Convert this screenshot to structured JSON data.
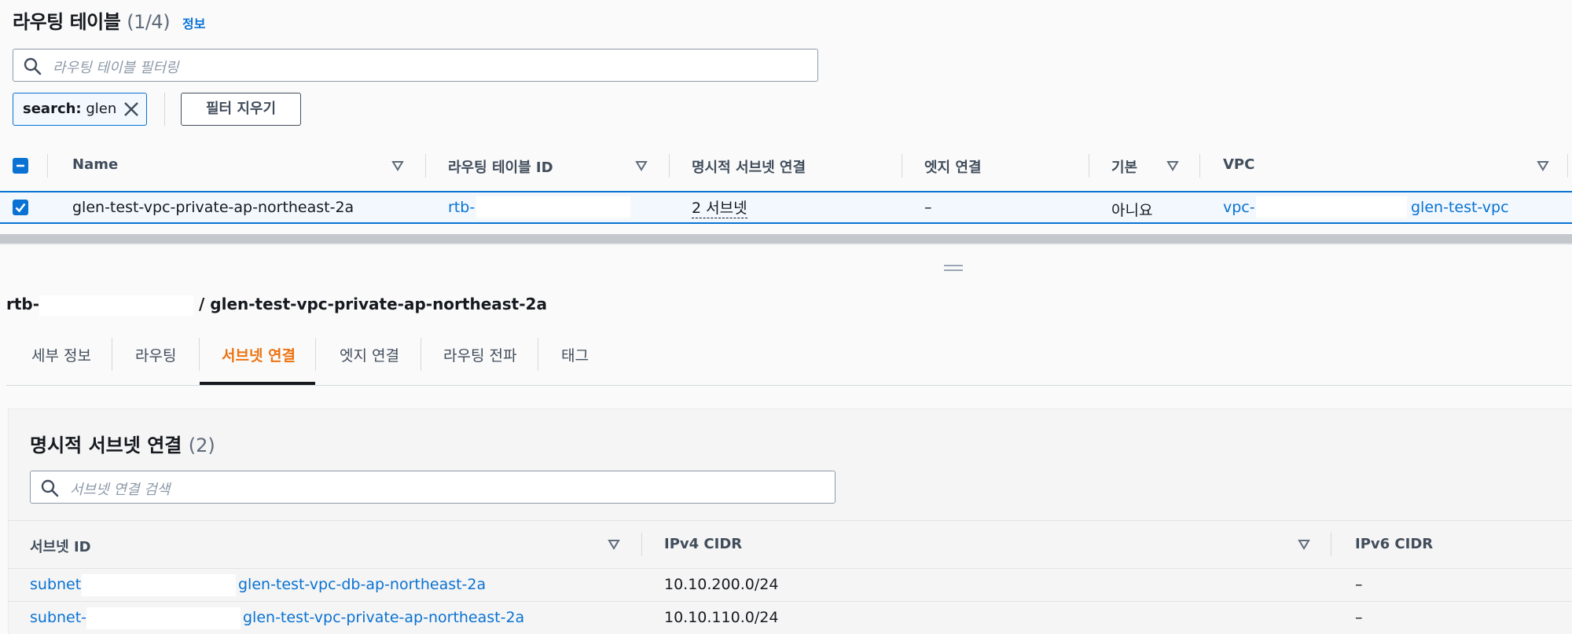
{
  "route_tables": {
    "title": "라우팅 테이블",
    "count": "(1/4)",
    "info_link": "정보",
    "search_placeholder": "라우팅 테이블 필터링",
    "filter_token": {
      "key": "search:",
      "value": "glen"
    },
    "clear_filter_label": "필터 지우기",
    "columns": [
      "Name",
      "라우팅 테이블 ID",
      "명시적 서브넷 연결",
      "엣지 연결",
      "기본",
      "VPC"
    ],
    "rows": [
      {
        "name": "glen-test-vpc-private-ap-northeast-2a",
        "route_table_id": "rtb-",
        "explicit_subnet_assoc": "2 서브넷",
        "edge_assoc": "–",
        "main": "아니요",
        "vpc_id": "vpc-",
        "vpc_name": "glen-test-vpc"
      }
    ]
  },
  "detail": {
    "title_id": "rtb-",
    "title_rest": "/ glen-test-vpc-private-ap-northeast-2a",
    "tabs": [
      "세부 정보",
      "라우팅",
      "서브넷 연결",
      "엣지 연결",
      "라우팅 전파",
      "태그"
    ],
    "active_tab": "서브넷 연결",
    "subnet_assoc": {
      "title": "명시적 서브넷 연결",
      "count": "(2)",
      "search_placeholder": "서브넷 연결 검색",
      "columns": [
        "서브넷 ID",
        "IPv4 CIDR",
        "IPv6 CIDR"
      ],
      "rows": [
        {
          "subnet_id": "subnet-",
          "subnet_name": "glen-test-vpc-db-ap-northeast-2a",
          "ipv4": "10.10.200.0/24",
          "ipv6": "–"
        },
        {
          "subnet_id": "subnet-",
          "subnet_name": "glen-test-vpc-private-ap-northeast-2a",
          "ipv4": "10.10.110.0/24",
          "ipv6": "–"
        }
      ]
    }
  },
  "icons": {
    "search": "search-icon",
    "close": "close-icon",
    "sort": "sort-caret-icon",
    "checkbox_checked": "checkbox-checked-icon",
    "checkbox_indeterminate": "checkbox-indeterminate-icon",
    "grabber": "resize-handle-icon"
  },
  "colors": {
    "link": "#0972d3",
    "active_tab": "#ec7211",
    "selected_row_bg": "#f2f8fd"
  }
}
